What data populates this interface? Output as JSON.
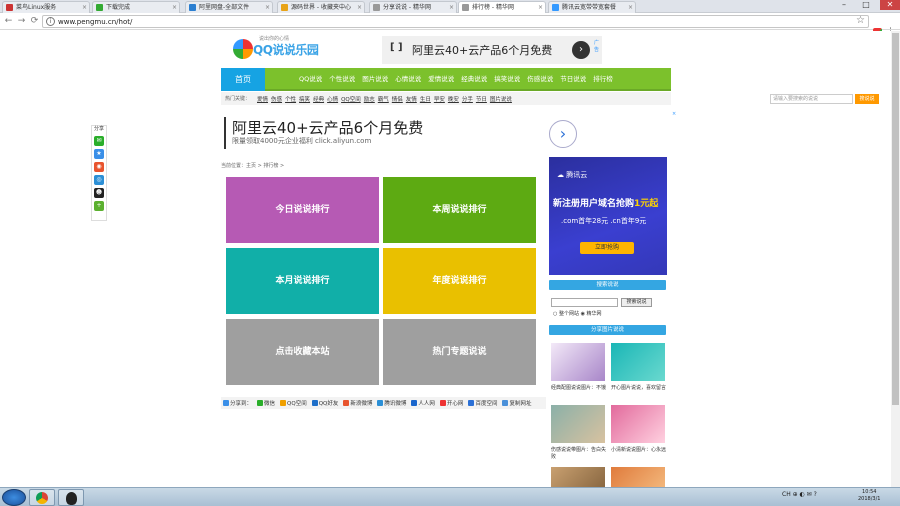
{
  "browser": {
    "tabs": [
      {
        "title": "菜鸟Linux服务",
        "color": "#c33"
      },
      {
        "title": "下载完成",
        "color": "#3a3"
      },
      {
        "title": "阿里网盘-全部文件",
        "color": "#2b7fd1"
      },
      {
        "title": "源码世界 - 收藏夹中心",
        "color": "#e8a317"
      },
      {
        "title": "分享说说 - 精华网",
        "color": "#999"
      },
      {
        "title": "排行榜 - 精华网",
        "color": "#999"
      },
      {
        "title": "腾讯云宽带带宽套餐",
        "color": "#39f"
      }
    ],
    "active_tab": 5,
    "url": "www.pengmu.cn/hot/",
    "nav": {
      "back": "←",
      "forward": "→",
      "reload": "⟳"
    },
    "window_controls": {
      "minimize": "–",
      "maximize": "□",
      "close": "✕"
    }
  },
  "site": {
    "logo_text": "QQ说说乐园",
    "logo_slogan": "说出你的心情",
    "top_ad": {
      "text": "阿里云40+云产品6个月免费",
      "go": "›",
      "ad_mark": "广告"
    },
    "nav": {
      "home": "首页",
      "links": [
        "QQ说说",
        "个性说说",
        "图片说说",
        "心情说说",
        "爱情说说",
        "经典说说",
        "搞笑说说",
        "伤感说说",
        "节日说说",
        "排行榜"
      ]
    },
    "subnav": {
      "label": "热门关键：",
      "keywords": [
        "爱情",
        "伤感",
        "个性",
        "搞笑",
        "经典",
        "心情",
        "QQ空间",
        "励志",
        "霸气",
        "情侣",
        "友情",
        "生日",
        "早安",
        "晚安",
        "分手",
        "节日",
        "图片说说"
      ],
      "search_placeholder": "请输入要搜索的说说",
      "search_button": "搜说说"
    },
    "share_float": {
      "title": "分享"
    },
    "ad_text": {
      "title": "阿里云40+云产品6个月免费",
      "sub": "限量领取4000元企业福利 click.aliyun.com",
      "next": "›",
      "close": "×"
    },
    "breadcrumb": "当前位置：主页 > 排行榜 >",
    "tiles": [
      {
        "label": "今日说说排行",
        "color": "#b65ab4"
      },
      {
        "label": "本周说说排行",
        "color": "#5daa12"
      },
      {
        "label": "本月说说排行",
        "color": "#11afa8"
      },
      {
        "label": "年度说说排行",
        "color": "#e9c000"
      },
      {
        "label": "点击收藏本站",
        "color": "#9f9f9f"
      },
      {
        "label": "热门专题说说",
        "color": "#9f9f9f"
      }
    ],
    "share_bar": [
      "分享到：",
      "微信",
      "QQ空间",
      "QQ好友",
      "新浪微博",
      "腾讯微博",
      "人人网",
      "开心网",
      "百度空间",
      "复制网址"
    ],
    "tencent_ad": {
      "brand": "腾讯云",
      "headline": "新注册用户域名抢购",
      "price": "1元起",
      "sub": ".com首年28元 .cn首年9元",
      "button": "立即抢购"
    },
    "sidebar": {
      "search_title": "搜索说说",
      "search_button": "搜索说说",
      "radio_all": "整个网站",
      "radio_site": "精华网",
      "pics_title": "分享图片说说",
      "pics": [
        {
          "caption": "经典配图说说图片：不饿",
          "c1": "#f3e9f8",
          "c2": "#a886c9"
        },
        {
          "caption": "开心图片说说，喜欢留言",
          "c1": "#1ab6b6",
          "c2": "#6ad9cf"
        },
        {
          "caption": "伤感说说带图片：告白失败",
          "c1": "#8bb0a8",
          "c2": "#d8c2a0"
        },
        {
          "caption": "小清新说说图片：心永远",
          "c1": "#e26a9c",
          "c2": "#ffd1e0"
        },
        {
          "caption": "",
          "c1": "#c9a070",
          "c2": "#7a5a36"
        },
        {
          "caption": "",
          "c1": "#e07b3c",
          "c2": "#f7c58a"
        }
      ]
    }
  },
  "taskbar": {
    "tray": "CH ⊕ ◐ ✉ ?",
    "time": "10:54",
    "date": "2018/3/1"
  }
}
